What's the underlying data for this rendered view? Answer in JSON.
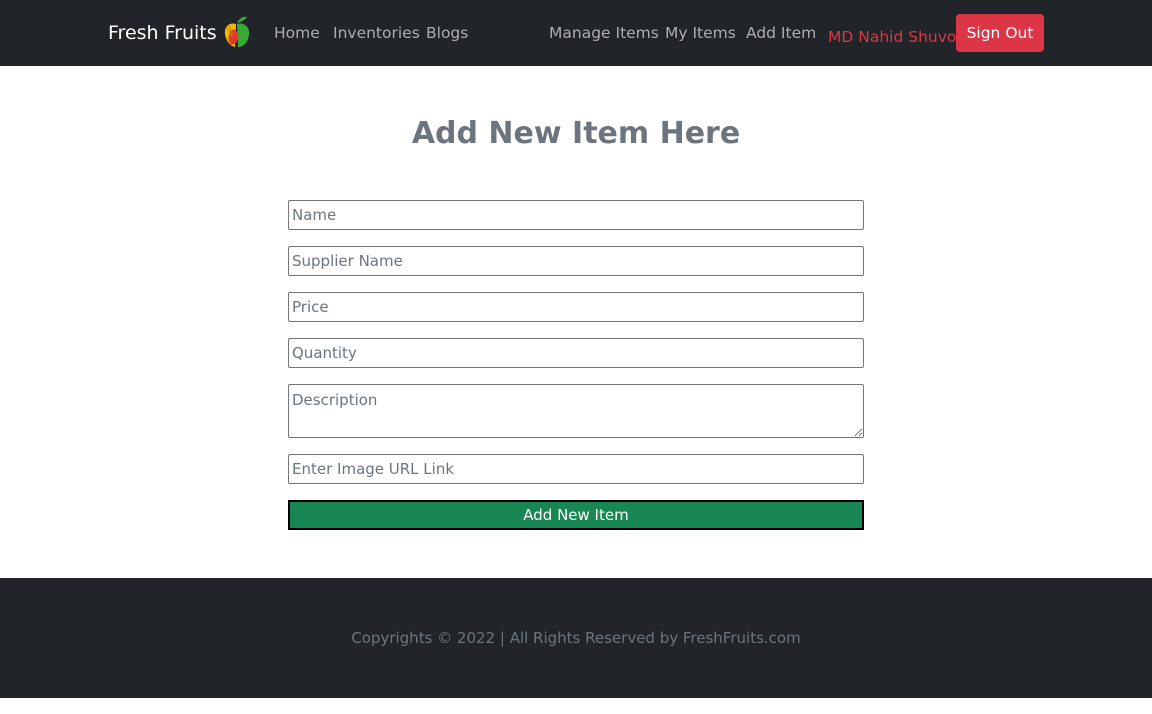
{
  "navbar": {
    "brand": "Fresh Fruits",
    "brand_icon": "fruit-logo-icon",
    "links": [
      "Home",
      "Inventories",
      "Blogs",
      "Manage Items",
      "My Items",
      "Add Item"
    ],
    "user_name": "MD Nahid Shuvo",
    "signout_label": "Sign Out",
    "colors": {
      "background": "#212529",
      "danger": "#dc3545"
    }
  },
  "main": {
    "title": "Add New Item Here",
    "form": {
      "name_placeholder": "Name",
      "supplier_placeholder": "Supplier Name",
      "price_placeholder": "Price",
      "quantity_placeholder": "Quantity",
      "description_placeholder": "Description",
      "image_placeholder": "Enter Image URL Link",
      "submit_label": "Add New Item",
      "submit_color": "#198754"
    }
  },
  "footer": {
    "text": "Copyrights © 2022 | All Rights Reserved by FreshFruits.com"
  }
}
